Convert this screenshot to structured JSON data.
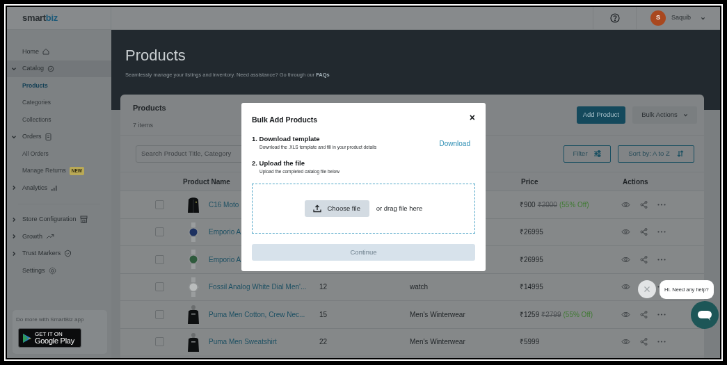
{
  "header": {
    "logo_prefix": "smart",
    "logo_suffix": "biz",
    "user": {
      "initial": "S",
      "name": "Saquib"
    }
  },
  "sidebar": {
    "sections": [
      {
        "items": [
          {
            "kind": "link",
            "label": "Home"
          },
          {
            "kind": "group",
            "label": "Catalog",
            "expanded": true,
            "children": [
              {
                "label": "Products",
                "selected": true
              },
              {
                "label": "Categories",
                "selected": false
              },
              {
                "label": "Collections",
                "selected": false
              }
            ]
          },
          {
            "kind": "group",
            "label": "Orders",
            "expanded": true,
            "children": [
              {
                "label": "All Orders",
                "selected": false
              },
              {
                "label": "Manage Returns",
                "selected": false,
                "badge": "NEW"
              }
            ]
          },
          {
            "kind": "group",
            "label": "Analytics",
            "expanded": false
          }
        ]
      },
      {
        "items": [
          {
            "kind": "group",
            "label": "Store Configuration",
            "expanded": false
          },
          {
            "kind": "group",
            "label": "Growth",
            "expanded": false
          },
          {
            "kind": "group",
            "label": "Trust Markers",
            "expanded": false
          },
          {
            "kind": "link",
            "label": "Settings"
          }
        ]
      }
    ],
    "app_card": {
      "text": "Do more with SmartBiz app",
      "badge_small": "GET IT ON",
      "badge_large": "Google Play"
    }
  },
  "page": {
    "title": "Products",
    "subtitle": "Seamlessly manage your listings and inventory. Need assistance? Go through our",
    "subtitle_link": "FAQs"
  },
  "card": {
    "title": "Products",
    "count": "7 items",
    "buttons": [
      "Add Product",
      "Bulk Actions"
    ],
    "search": {
      "placeholder": "Search Product Title, Category"
    },
    "filter": "Filter",
    "sort": "Sort by: A to Z"
  },
  "table": {
    "columns": [
      "Product Name",
      "Price",
      "Actions"
    ],
    "rows": [
      {
        "checked": false,
        "name": "C16 Moto",
        "price": "₹900",
        "price_original": "₹2000",
        "discount": "(55% Off)"
      },
      {
        "checked": false,
        "name": "Emporio A",
        "price": "₹26995"
      },
      {
        "checked": false,
        "name": "Emporio A",
        "price": "₹26995"
      },
      {
        "checked": false,
        "name": "Fossil Analog White Dial Men'...",
        "quantity": "12",
        "category": "watch",
        "price": "₹14995"
      },
      {
        "checked": false,
        "name": "Puma Men Cotton, Crew Nec...",
        "quantity": "15",
        "category": "Men's Winterwear",
        "price": "₹1259",
        "price_original": "₹2799",
        "discount": "(55% Off)"
      },
      {
        "checked": false,
        "name": "Puma Men Sweatshirt",
        "quantity": "22",
        "category": "Men's Winterwear",
        "price": "₹5999"
      }
    ]
  },
  "modal": {
    "title": "Bulk Add Products",
    "close": "×",
    "steps": [
      {
        "title": "1. Download template",
        "description": "Download the .XLS template and fill in your product details",
        "action": "Download"
      },
      {
        "title": "2. Upload the file",
        "description": "Upload the completed catalog file below"
      }
    ],
    "dropzone": {
      "button": "Choose file",
      "hint": "or drag file here"
    },
    "continue": {
      "label": "Continue",
      "disabled": true
    }
  },
  "chat": {
    "bubble": "Hi. Need any help?"
  }
}
